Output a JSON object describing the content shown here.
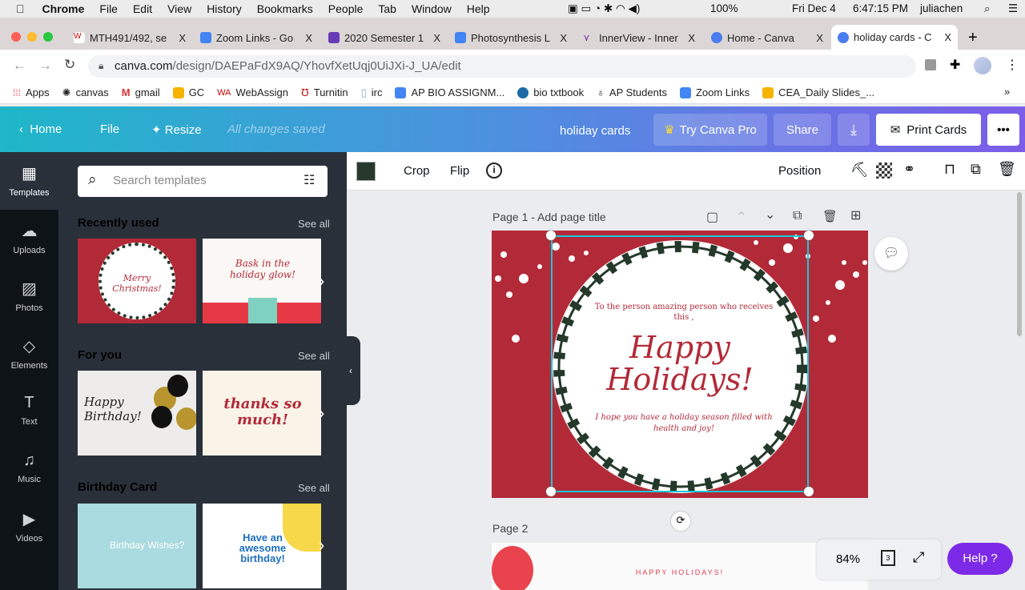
{
  "menubar": {
    "app": "Chrome",
    "items": [
      "File",
      "Edit",
      "View",
      "History",
      "Bookmarks",
      "People",
      "Tab",
      "Window",
      "Help"
    ],
    "battery": "100%",
    "date": "Fri Dec 4",
    "time": "6:47:15 PM",
    "user": "juliachen"
  },
  "tabs": [
    {
      "title": "MTH491/492, se",
      "close": "X"
    },
    {
      "title": "Zoom Links - Go",
      "close": "X"
    },
    {
      "title": "2020 Semester 1",
      "close": "X"
    },
    {
      "title": "Photosynthesis L",
      "close": "X"
    },
    {
      "title": "InnerView - Inner",
      "close": "X"
    },
    {
      "title": "Home - Canva",
      "close": "X"
    },
    {
      "title": "holiday cards - C",
      "close": "X"
    }
  ],
  "new_tab": "+",
  "url": {
    "host": "canva.com",
    "path": "/design/DAEPaFdX9AQ/YhovfXetUqj0UiJXi-J_UA/edit"
  },
  "bookmarks": [
    "Apps",
    "canvas",
    "gmail",
    "GC",
    "WebAssign",
    "Turnitin",
    "irc",
    "AP BIO ASSIGNM...",
    "bio txtbook",
    "AP Students",
    "Zoom Links",
    "CEA_Daily Slides_..."
  ],
  "bookmarks_more": "»",
  "canva_header": {
    "home": "Home",
    "file": "File",
    "resize": "Resize",
    "status": "All changes saved",
    "title": "holiday cards",
    "try_pro": "Try Canva Pro",
    "share": "Share",
    "print": "Print Cards",
    "more": "•••"
  },
  "rail": [
    {
      "label": "Templates",
      "icon": "▦"
    },
    {
      "label": "Uploads",
      "icon": "☁"
    },
    {
      "label": "Photos",
      "icon": "▨"
    },
    {
      "label": "Elements",
      "icon": "◇"
    },
    {
      "label": "Text",
      "icon": "T"
    },
    {
      "label": "Music",
      "icon": "♫"
    },
    {
      "label": "Videos",
      "icon": "▶"
    }
  ],
  "panel": {
    "search_placeholder": "Search templates",
    "sections": [
      {
        "title": "Recently used",
        "see_all": "See all",
        "thumbs": [
          "Merry Christmas!",
          "Bask in the holiday glow!"
        ]
      },
      {
        "title": "For you",
        "see_all": "See all",
        "thumbs": [
          "Happy Birthday!",
          "thanks so much!"
        ]
      },
      {
        "title": "Birthday Card",
        "see_all": "See all",
        "thumbs": [
          "Birthday Wishes?",
          "Have an awesome birthday!"
        ]
      }
    ]
  },
  "toolbar": {
    "color": "#27392c",
    "crop": "Crop",
    "flip": "Flip",
    "info": "i",
    "position": "Position"
  },
  "page1": {
    "label": "Page 1",
    "title_placeholder": "- Add page title"
  },
  "card": {
    "intro": "To the person amazing person who receives this ,",
    "headline1": "Happy",
    "headline2": "Holidays!",
    "message": "I hope you have a holiday season filled with health and joy!",
    "bg": "#b22a38",
    "text_color": "#b22a38",
    "wreath": "#24392a"
  },
  "page2": {
    "label": "Page 2",
    "text": "HAPPY HOLIDAYS!"
  },
  "zoom": {
    "level": "84%",
    "pages": "3"
  },
  "help": "Help ?"
}
